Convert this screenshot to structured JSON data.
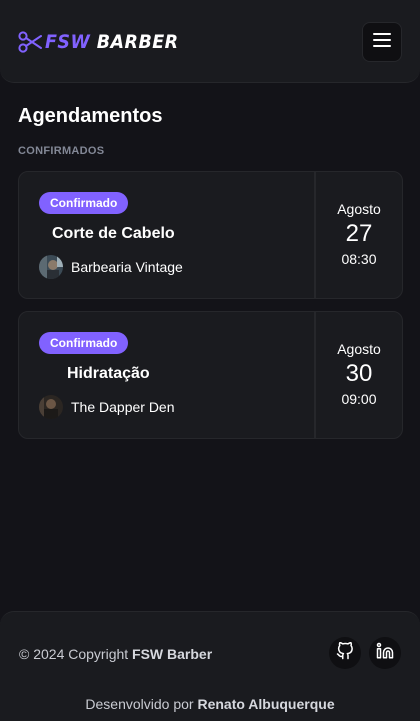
{
  "header": {
    "logo_fsw": "FSW",
    "logo_barber": "BARBER",
    "menu_icon": "menu-icon"
  },
  "page": {
    "title": "Agendamentos",
    "section_label": "CONFIRMADOS"
  },
  "bookings": [
    {
      "status": "Confirmado",
      "service": "Corte de Cabelo",
      "barbershop": "Barbearia Vintage",
      "month": "Agosto",
      "day": "27",
      "time": "08:30"
    },
    {
      "status": "Confirmado",
      "service": "Hidratação",
      "barbershop": "The Dapper Den",
      "month": "Agosto",
      "day": "30",
      "time": "09:00"
    }
  ],
  "footer": {
    "copyright_prefix": "© 2024 Copyright ",
    "copyright_brand": "FSW Barber",
    "developed_prefix": "Desenvolvido por ",
    "developer": "Renato Albuquerque",
    "social_icons": [
      "github-icon",
      "linkedin-icon"
    ]
  },
  "colors": {
    "accent": "#8162ff",
    "background": "#131318",
    "card": "#1a1b1f",
    "border": "#26272b"
  }
}
